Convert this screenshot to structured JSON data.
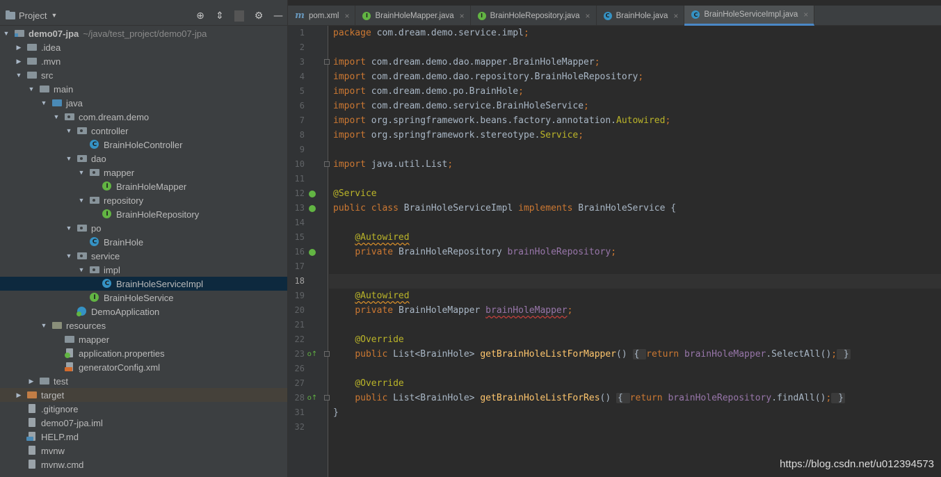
{
  "project_panel": {
    "title": "Project",
    "root": {
      "name": "demo07-jpa",
      "path": "~/java/test_project/demo07-jpa"
    }
  },
  "tree": [
    {
      "label": ".idea",
      "depth": 1,
      "arrow": "▶",
      "icon": "folder"
    },
    {
      "label": ".mvn",
      "depth": 1,
      "arrow": "▶",
      "icon": "folder"
    },
    {
      "label": "src",
      "depth": 1,
      "arrow": "▼",
      "icon": "folder"
    },
    {
      "label": "main",
      "depth": 2,
      "arrow": "▼",
      "icon": "folder"
    },
    {
      "label": "java",
      "depth": 3,
      "arrow": "▼",
      "icon": "folder-src"
    },
    {
      "label": "com.dream.demo",
      "depth": 4,
      "arrow": "▼",
      "icon": "pkg"
    },
    {
      "label": "controller",
      "depth": 5,
      "arrow": "▼",
      "icon": "pkg"
    },
    {
      "label": "BrainHoleController",
      "depth": 6,
      "arrow": "",
      "icon": "cls"
    },
    {
      "label": "dao",
      "depth": 5,
      "arrow": "▼",
      "icon": "pkg"
    },
    {
      "label": "mapper",
      "depth": 6,
      "arrow": "▼",
      "icon": "pkg"
    },
    {
      "label": "BrainHoleMapper",
      "depth": 7,
      "arrow": "",
      "icon": "ifc"
    },
    {
      "label": "repository",
      "depth": 6,
      "arrow": "▼",
      "icon": "pkg"
    },
    {
      "label": "BrainHoleRepository",
      "depth": 7,
      "arrow": "",
      "icon": "ifc"
    },
    {
      "label": "po",
      "depth": 5,
      "arrow": "▼",
      "icon": "pkg"
    },
    {
      "label": "BrainHole",
      "depth": 6,
      "arrow": "",
      "icon": "cls"
    },
    {
      "label": "service",
      "depth": 5,
      "arrow": "▼",
      "icon": "pkg"
    },
    {
      "label": "impl",
      "depth": 6,
      "arrow": "▼",
      "icon": "pkg"
    },
    {
      "label": "BrainHoleServiceImpl",
      "depth": 7,
      "arrow": "",
      "icon": "cls",
      "selected": true
    },
    {
      "label": "BrainHoleService",
      "depth": 6,
      "arrow": "",
      "icon": "ifc"
    },
    {
      "label": "DemoApplication",
      "depth": 5,
      "arrow": "",
      "icon": "app"
    },
    {
      "label": "resources",
      "depth": 3,
      "arrow": "▼",
      "icon": "folder-res"
    },
    {
      "label": "mapper",
      "depth": 4,
      "arrow": "",
      "icon": "folder"
    },
    {
      "label": "application.properties",
      "depth": 4,
      "arrow": "",
      "icon": "props"
    },
    {
      "label": "generatorConfig.xml",
      "depth": 4,
      "arrow": "",
      "icon": "xml"
    },
    {
      "label": "test",
      "depth": 2,
      "arrow": "▶",
      "icon": "folder"
    },
    {
      "label": "target",
      "depth": 1,
      "arrow": "▶",
      "icon": "folder-target",
      "highlight": true
    },
    {
      "label": ".gitignore",
      "depth": 1,
      "arrow": "",
      "icon": "file"
    },
    {
      "label": "demo07-jpa.iml",
      "depth": 1,
      "arrow": "",
      "icon": "file"
    },
    {
      "label": "HELP.md",
      "depth": 1,
      "arrow": "",
      "icon": "md"
    },
    {
      "label": "mvnw",
      "depth": 1,
      "arrow": "",
      "icon": "file"
    },
    {
      "label": "mvnw.cmd",
      "depth": 1,
      "arrow": "",
      "icon": "file"
    }
  ],
  "tabs": [
    {
      "label": "pom.xml",
      "type": "m",
      "active": false
    },
    {
      "label": "BrainHoleMapper.java",
      "type": "i",
      "active": false
    },
    {
      "label": "BrainHoleRepository.java",
      "type": "i",
      "active": false
    },
    {
      "label": "BrainHole.java",
      "type": "c",
      "active": false
    },
    {
      "label": "BrainHoleServiceImpl.java",
      "type": "c",
      "active": true
    }
  ],
  "code_lines": [
    {
      "n": "1",
      "tokens": [
        [
          "kw",
          "package "
        ],
        [
          "",
          "com.dream.demo.service.impl"
        ],
        [
          "kw",
          ";"
        ]
      ]
    },
    {
      "n": "2",
      "tokens": []
    },
    {
      "n": "3",
      "fold": true,
      "tokens": [
        [
          "kw",
          "import "
        ],
        [
          "",
          "com.dream.demo.dao.mapper.BrainHoleMapper"
        ],
        [
          "kw",
          ";"
        ]
      ]
    },
    {
      "n": "4",
      "tokens": [
        [
          "kw",
          "import "
        ],
        [
          "",
          "com.dream.demo.dao.repository.BrainHoleRepository"
        ],
        [
          "kw",
          ";"
        ]
      ]
    },
    {
      "n": "5",
      "tokens": [
        [
          "kw",
          "import "
        ],
        [
          "",
          "com.dream.demo.po.BrainHole"
        ],
        [
          "kw",
          ";"
        ]
      ]
    },
    {
      "n": "6",
      "tokens": [
        [
          "kw",
          "import "
        ],
        [
          "",
          "com.dream.demo.service.BrainHoleService"
        ],
        [
          "kw",
          ";"
        ]
      ]
    },
    {
      "n": "7",
      "tokens": [
        [
          "kw",
          "import "
        ],
        [
          "",
          "org.springframework.beans.factory.annotation."
        ],
        [
          "ann",
          "Autowired"
        ],
        [
          "kw",
          ";"
        ]
      ]
    },
    {
      "n": "8",
      "tokens": [
        [
          "kw",
          "import "
        ],
        [
          "",
          "org.springframework.stereotype."
        ],
        [
          "ann",
          "Service"
        ],
        [
          "kw",
          ";"
        ]
      ]
    },
    {
      "n": "9",
      "tokens": []
    },
    {
      "n": "10",
      "fold": true,
      "tokens": [
        [
          "kw",
          "import "
        ],
        [
          "",
          "java.util.List"
        ],
        [
          "kw",
          ";"
        ]
      ]
    },
    {
      "n": "11",
      "tokens": []
    },
    {
      "n": "12",
      "mark": "bean",
      "tokens": [
        [
          "ann",
          "@Service"
        ]
      ]
    },
    {
      "n": "13",
      "mark": "bean",
      "tokens": [
        [
          "kw",
          "public class "
        ],
        [
          "",
          "BrainHoleServiceImpl "
        ],
        [
          "kw",
          "implements "
        ],
        [
          "",
          "BrainHoleService {"
        ]
      ]
    },
    {
      "n": "14",
      "tokens": []
    },
    {
      "n": "15",
      "tokens": [
        [
          "",
          "    "
        ],
        [
          "ann wavy",
          "@Autowired"
        ]
      ]
    },
    {
      "n": "16",
      "mark": "bean",
      "tokens": [
        [
          "",
          "    "
        ],
        [
          "kw",
          "private "
        ],
        [
          "",
          "BrainHoleRepository "
        ],
        [
          "fld",
          "brainHoleRepository"
        ],
        [
          "kw",
          ";"
        ]
      ]
    },
    {
      "n": "17",
      "tokens": []
    },
    {
      "n": "18",
      "current": true,
      "tokens": []
    },
    {
      "n": "19",
      "tokens": [
        [
          "",
          "    "
        ],
        [
          "ann wavy",
          "@Autowired"
        ]
      ]
    },
    {
      "n": "20",
      "tokens": [
        [
          "",
          "    "
        ],
        [
          "kw",
          "private "
        ],
        [
          "",
          "BrainHoleMapper "
        ],
        [
          "fld wavy-red",
          "brainHoleMapper"
        ],
        [
          "kw",
          ";"
        ]
      ]
    },
    {
      "n": "21",
      "tokens": []
    },
    {
      "n": "22",
      "tokens": [
        [
          "",
          "    "
        ],
        [
          "ann",
          "@Override"
        ]
      ]
    },
    {
      "n": "23",
      "mark": "override",
      "fold": true,
      "tokens": [
        [
          "",
          "    "
        ],
        [
          "kw",
          "public "
        ],
        [
          "",
          "List<BrainHole> "
        ],
        [
          "mth",
          "getBrainHoleListForMapper"
        ],
        [
          "",
          "() "
        ],
        [
          "fold-box",
          "{ "
        ],
        [
          "kw",
          "return "
        ],
        [
          "fld",
          "brainHoleMapper"
        ],
        [
          "",
          ".SelectAll()"
        ],
        [
          "kw",
          ";"
        ],
        [
          "fold-box",
          " }"
        ]
      ]
    },
    {
      "n": "26",
      "tokens": []
    },
    {
      "n": "27",
      "tokens": [
        [
          "",
          "    "
        ],
        [
          "ann",
          "@Override"
        ]
      ]
    },
    {
      "n": "28",
      "mark": "override",
      "fold": true,
      "tokens": [
        [
          "",
          "    "
        ],
        [
          "kw",
          "public "
        ],
        [
          "",
          "List<BrainHole> "
        ],
        [
          "mth",
          "getBrainHoleListForRes"
        ],
        [
          "",
          "() "
        ],
        [
          "fold-box",
          "{ "
        ],
        [
          "kw",
          "return "
        ],
        [
          "fld",
          "brainHoleRepository"
        ],
        [
          "",
          ".findAll()"
        ],
        [
          "kw",
          ";"
        ],
        [
          "fold-box",
          " }"
        ]
      ]
    },
    {
      "n": "31",
      "tokens": [
        [
          "",
          "}"
        ]
      ]
    },
    {
      "n": "32",
      "tokens": []
    }
  ],
  "watermark": "https://blog.csdn.net/u012394573",
  "colors": {
    "keyword": "#cc7832",
    "annotation": "#bbb529",
    "field": "#9876aa",
    "method": "#ffc66d",
    "text": "#a9b7c6",
    "selection": "#0d293e"
  }
}
